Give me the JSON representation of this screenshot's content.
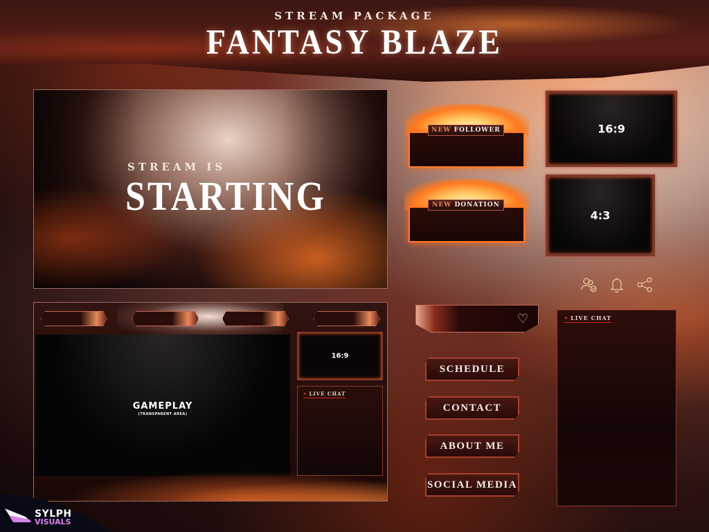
{
  "header": {
    "subtitle": "STREAM PACKAGE",
    "title": "FANTASY BLAZE"
  },
  "starting_screen": {
    "subtitle": "STREAM IS",
    "title": "STARTING"
  },
  "alerts": [
    {
      "prefix": "NEW",
      "label": "FOLLOWER"
    },
    {
      "prefix": "NEW",
      "label": "DONATION"
    }
  ],
  "webcams": [
    {
      "ratio": "16:9"
    },
    {
      "ratio": "4:3"
    }
  ],
  "social_icons": [
    "users-check-icon",
    "bell-icon",
    "share-icon"
  ],
  "gameplay": {
    "label": "GAMEPLAY",
    "sublabel": "(TRANSPARENT AREA)",
    "cam_ratio": "16:9",
    "chat_title": "LIVE CHAT"
  },
  "panels": {
    "heart_icon": "heart-icon",
    "buttons": [
      "SCHEDULE",
      "CONTACT",
      "ABOUT ME",
      "SOCIAL MEDIA"
    ]
  },
  "side_chat": {
    "title": "LIVE CHAT"
  },
  "brand": {
    "line1": "SYLPH",
    "line2": "VISUALS",
    "accent": "#d880e8"
  },
  "colors": {
    "fire": "#ff7a1e",
    "frame": "#a8402e",
    "chat_underline": "#d02a1a"
  }
}
